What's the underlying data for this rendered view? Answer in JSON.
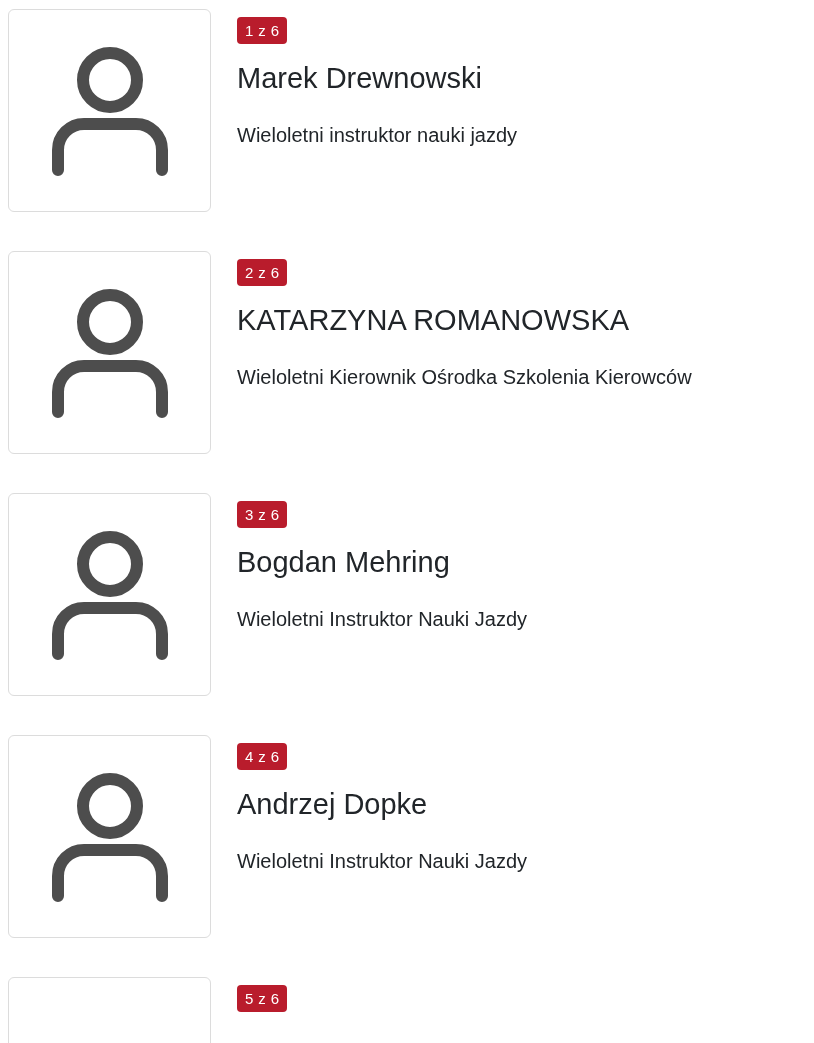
{
  "people": [
    {
      "badge": "1 z 6",
      "name": "Marek Drewnowski",
      "role": "Wieloletni instruktor nauki jazdy",
      "avatar": true
    },
    {
      "badge": "2 z 6",
      "name": "KATARZYNA ROMANOWSKA",
      "role": "Wieloletni Kierownik Ośrodka Szkolenia Kierowców",
      "avatar": true
    },
    {
      "badge": "3 z 6",
      "name": "Bogdan Mehring",
      "role": "Wieloletni Instruktor Nauki Jazdy",
      "avatar": true
    },
    {
      "badge": "4 z 6",
      "name": "Andrzej Dopke",
      "role": "Wieloletni Instruktor Nauki Jazdy",
      "avatar": true
    },
    {
      "badge": "5 z 6",
      "avatar": false
    }
  ]
}
